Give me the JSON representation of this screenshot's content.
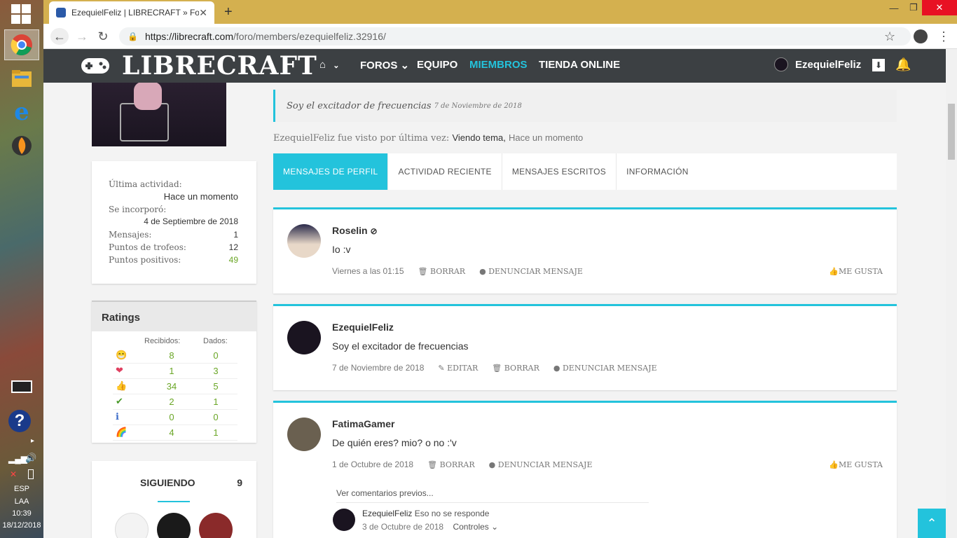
{
  "taskbar": {
    "lang": "ESP",
    "layout": "LAA",
    "time": "10:39",
    "date": "18/12/2018"
  },
  "browser": {
    "tab_title": "EzequielFeliz | LIBRECRAFT » Foro",
    "url_host": "https://librecraft.com",
    "url_path": "/foro/members/ezequielfeliz.32916/"
  },
  "site": {
    "logo": "LIBRECRAFT",
    "nav": [
      "FOROS",
      "EQUIPO",
      "MIEMBROS",
      "TIENDA ONLINE"
    ],
    "username": "EzequielFeliz"
  },
  "sidebar": {
    "stats": [
      {
        "label": "Última actividad:",
        "value": "Hace un momento"
      },
      {
        "label": "Se incorporó:",
        "value": "4 de Septiembre de 2018"
      },
      {
        "label": "Mensajes:",
        "value": "1"
      },
      {
        "label": "Puntos de trofeos:",
        "value": "12"
      },
      {
        "label": "Puntos positivos:",
        "value": "49"
      }
    ],
    "ratings_title": "Ratings",
    "ratings_headers": [
      "Recibidos:",
      "Dados:"
    ],
    "ratings": [
      {
        "icon": "funny-icon",
        "received": "8",
        "given": "0"
      },
      {
        "icon": "heart-icon",
        "received": "1",
        "given": "3"
      },
      {
        "icon": "thumbs-up-icon",
        "received": "34",
        "given": "5"
      },
      {
        "icon": "checkmark-icon",
        "received": "2",
        "given": "1"
      },
      {
        "icon": "info-icon",
        "received": "0",
        "given": "0"
      },
      {
        "icon": "rainbow-icon",
        "received": "4",
        "given": "1"
      }
    ],
    "following_label": "SIGUIENDO",
    "following_count": "9"
  },
  "profile": {
    "status_text": "Soy el excitador de frecuencias",
    "status_date": "7 de Noviembre de 2018",
    "last_seen_prefix": "EzequielFeliz fue visto por última vez:",
    "last_seen_action": "Viendo tema,",
    "last_seen_time": "Hace un momento",
    "tabs": [
      "MENSAJES DE PERFIL",
      "ACTIVIDAD RECIENTE",
      "MENSAJES ESCRITOS",
      "INFORMACIÓN"
    ]
  },
  "messages": [
    {
      "author": "Roselin",
      "body": "Io :v",
      "date": "Viernes a las 01:15",
      "actions": [
        "BORRAR",
        "DENUNCIAR MENSAJE"
      ],
      "like": "ME GUSTA"
    },
    {
      "author": "EzequielFeliz",
      "body": "Soy el excitador de frecuencias",
      "date": "7 de Noviembre de 2018",
      "actions": [
        "EDITAR",
        "BORRAR",
        "DENUNCIAR MENSAJE"
      ],
      "like": ""
    },
    {
      "author": "FatimaGamer",
      "body": "De quién eres? mio? o no :'v",
      "date": "1 de Octubre de 2018",
      "actions": [
        "BORRAR",
        "DENUNCIAR MENSAJE"
      ],
      "like": "ME GUSTA"
    }
  ],
  "comments": {
    "previous_link": "Ver comentarios previos...",
    "author": "EzequielFeliz",
    "text": "Eso no se responde",
    "date": "3 de Octubre de 2018",
    "controls": "Controles"
  },
  "colors": {
    "accent": "#23c3dc",
    "header": "#3c4043",
    "green": "#6aa626"
  }
}
